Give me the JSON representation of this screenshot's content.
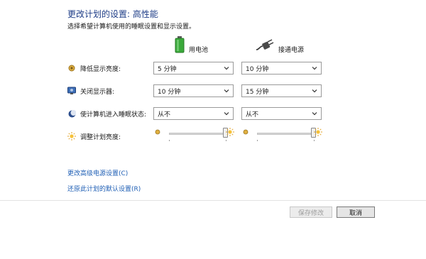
{
  "header": {
    "title": "更改计划的设置: 高性能",
    "subtitle": "选择希望计算机使用的睡眠设置和显示设置。"
  },
  "columns": {
    "battery": {
      "label": "用电池",
      "icon": "battery-icon"
    },
    "plugged": {
      "label": "接通电源",
      "icon": "power-plug-icon"
    }
  },
  "rows": [
    {
      "label": "降低显示亮度:",
      "icon": "dim-brightness-icon",
      "battery": "5 分钟",
      "plugged": "10 分钟"
    },
    {
      "label": "关闭显示器:",
      "icon": "monitor-off-icon",
      "battery": "10 分钟",
      "plugged": "15 分钟"
    },
    {
      "label": "使计算机进入睡眠状态:",
      "icon": "sleep-moon-icon",
      "battery": "从不",
      "plugged": "从不"
    }
  ],
  "brightness": {
    "label": "调整计划亮度:",
    "icon": "sun-icon",
    "battery_level": 1.0,
    "plugged_level": 1.0
  },
  "links": {
    "advanced": "更改高级电源设置(C)",
    "restore": "还原此计划的默认设置(R)"
  },
  "buttons": {
    "save": "保存修改",
    "cancel": "取消"
  },
  "colors": {
    "title": "#1e3d87",
    "link": "#1f5fb5",
    "battery_green": "#3aa93a"
  }
}
